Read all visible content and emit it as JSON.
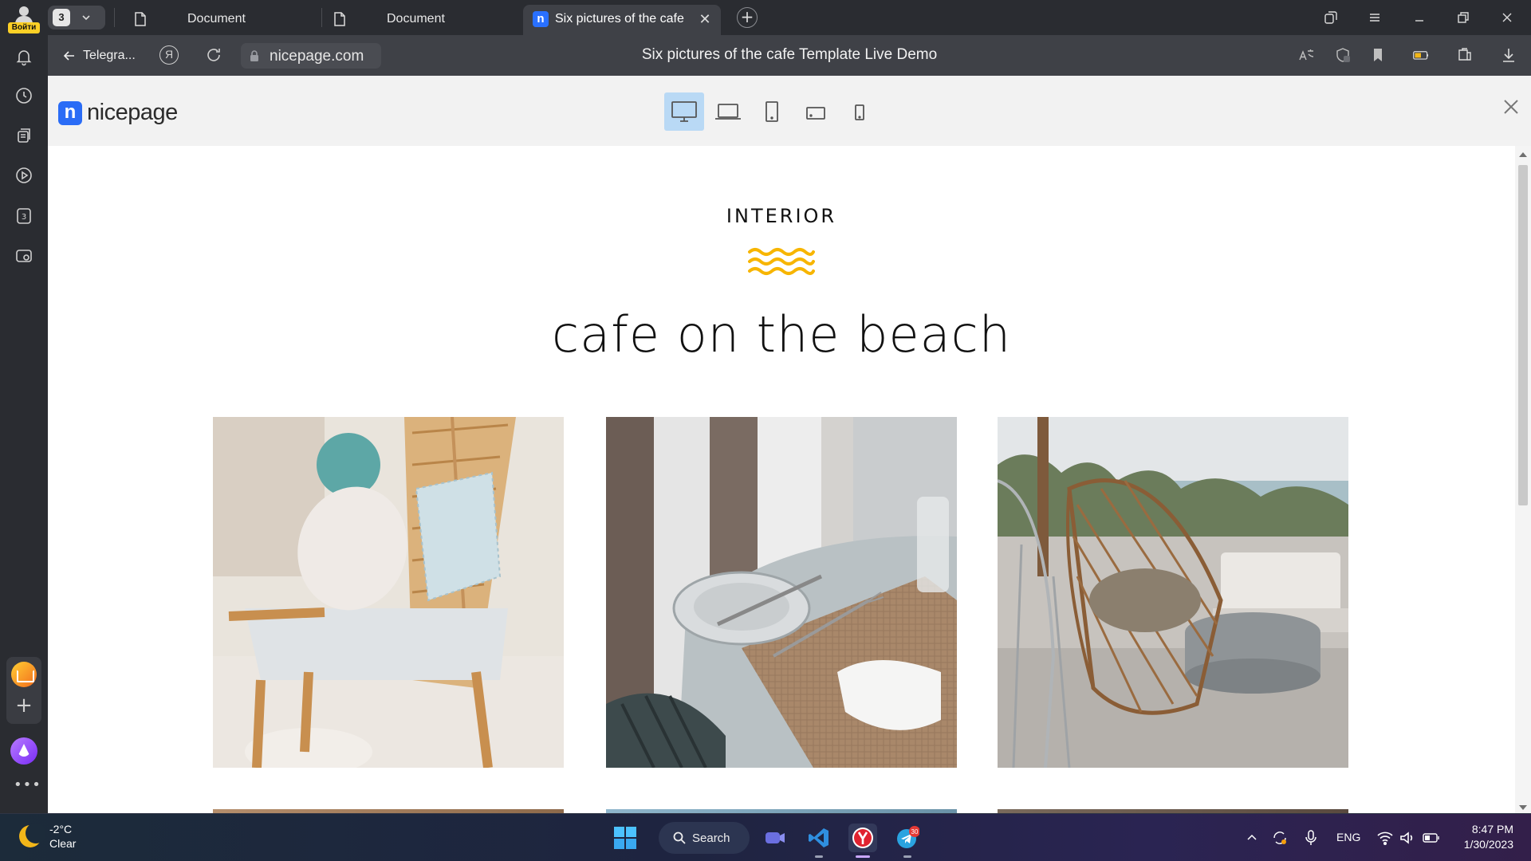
{
  "sidebar": {
    "login_label": "Войти",
    "icons": [
      "bell-icon",
      "history-icon",
      "collections-icon",
      "video-icon",
      "tabs-count-icon",
      "screenshot-icon"
    ]
  },
  "tabstrip": {
    "tab_count": "3",
    "tabs": [
      {
        "label": "Document",
        "active": false
      },
      {
        "label": "Document",
        "active": false
      },
      {
        "label": "Six pictures of the cafe Template Live Demo",
        "active": true
      }
    ]
  },
  "addressbar": {
    "back_label": "Telegra...",
    "url": "nicepage.com",
    "page_title": "Six pictures of the cafe Template Live Demo"
  },
  "preview": {
    "logo_text": "nicepage",
    "devices": [
      "desktop",
      "laptop",
      "tablet",
      "tablet-landscape",
      "phone"
    ],
    "selected_device": "desktop"
  },
  "content": {
    "kicker": "INTERIOR",
    "heading": "cafe on the beach",
    "accent_color": "#f7b500",
    "photos": [
      "rattan-chair-with-pillows",
      "table-setting-with-plate-and-fork",
      "wicker-egg-chairs-on-terrace"
    ]
  },
  "taskbar": {
    "weather_temp": "-2°C",
    "weather_desc": "Clear",
    "search_label": "Search",
    "telegram_badge": "30",
    "language": "ENG",
    "time": "8:47 PM",
    "date": "1/30/2023"
  }
}
